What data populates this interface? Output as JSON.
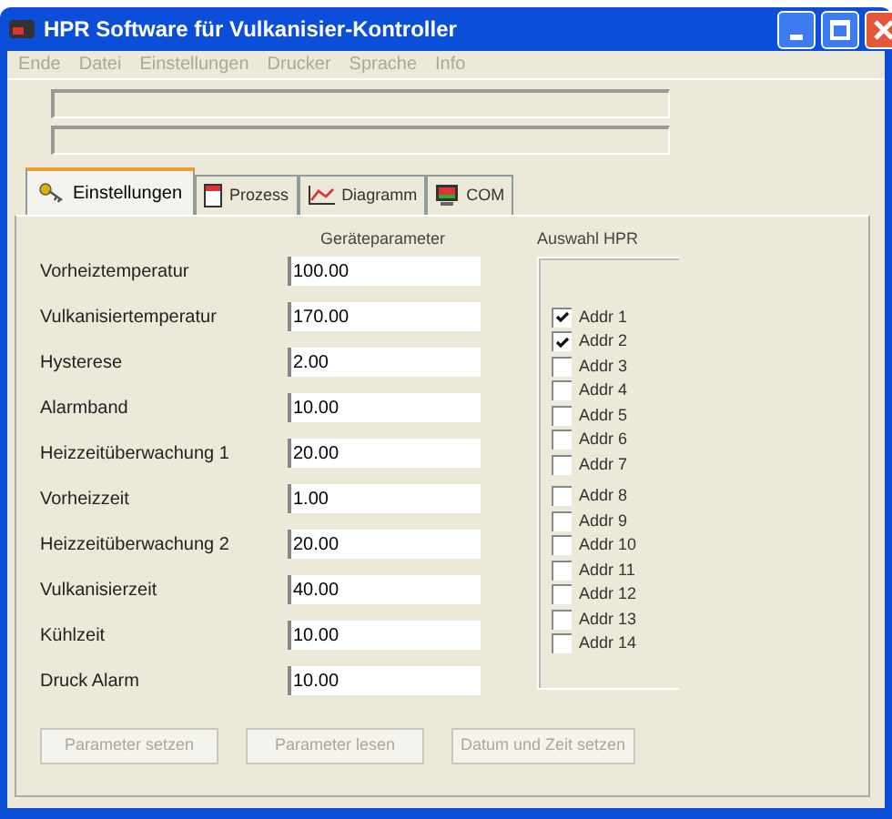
{
  "window": {
    "title": "HPR Software für Vulkanisier-Kontroller"
  },
  "menu": [
    {
      "label": "Ende",
      "disabled": true
    },
    {
      "label": "Datei",
      "disabled": true
    },
    {
      "label": "Einstellungen",
      "disabled": true
    },
    {
      "label": "Drucker",
      "disabled": true
    },
    {
      "label": "Sprache",
      "disabled": true
    },
    {
      "label": "Info",
      "disabled": true
    }
  ],
  "tabs": [
    {
      "label": "Einstellungen",
      "selected": true,
      "kind": "key"
    },
    {
      "label": "Prozess",
      "selected": false,
      "kind": "page"
    },
    {
      "label": "Diagramm",
      "selected": false,
      "kind": "chart"
    },
    {
      "label": "COM",
      "selected": false,
      "kind": "monitor"
    }
  ],
  "parameters_heading": "Geräteparameter",
  "parameters": [
    {
      "label": "Vorheiztemperatur",
      "value": "100.00"
    },
    {
      "label": "Vulkanisiertemperatur",
      "value": "170.00"
    },
    {
      "label": "Hysterese",
      "value": "2.00"
    },
    {
      "label": "Alarmband",
      "value": "10.00"
    },
    {
      "label": "Heizzeitüberwachung 1",
      "value": "20.00"
    },
    {
      "label": "Vorheizzeit",
      "value": "1.00"
    },
    {
      "label": "Heizzeitüberwachung 2",
      "value": "20.00"
    },
    {
      "label": "Vulkanisierzeit",
      "value": "40.00"
    },
    {
      "label": "Kühlzeit",
      "value": "10.00"
    },
    {
      "label": "Druck Alarm",
      "value": "10.00"
    }
  ],
  "hpr_heading": "Auswahl HPR",
  "addresses": [
    {
      "label": "Addr 1",
      "checked": true
    },
    {
      "label": "Addr 2",
      "checked": true
    },
    {
      "label": "Addr 3",
      "checked": false
    },
    {
      "label": "Addr 4",
      "checked": false
    },
    {
      "label": "Addr 5",
      "checked": false
    },
    {
      "label": "Addr 6",
      "checked": false
    },
    {
      "label": "Addr 7",
      "checked": false
    },
    {
      "label": "Addr 8",
      "checked": false
    },
    {
      "label": "Addr 9",
      "checked": false
    },
    {
      "label": "Addr 10",
      "checked": false
    },
    {
      "label": "Addr 11",
      "checked": false
    },
    {
      "label": "Addr 12",
      "checked": false
    },
    {
      "label": "Addr 13",
      "checked": false
    },
    {
      "label": "Addr 14",
      "checked": false
    }
  ],
  "buttons": [
    {
      "label": "Parameter setzen",
      "disabled": true
    },
    {
      "label": "Parameter lesen",
      "disabled": true
    },
    {
      "label": "Datum und Zeit setzen",
      "disabled": true
    }
  ]
}
